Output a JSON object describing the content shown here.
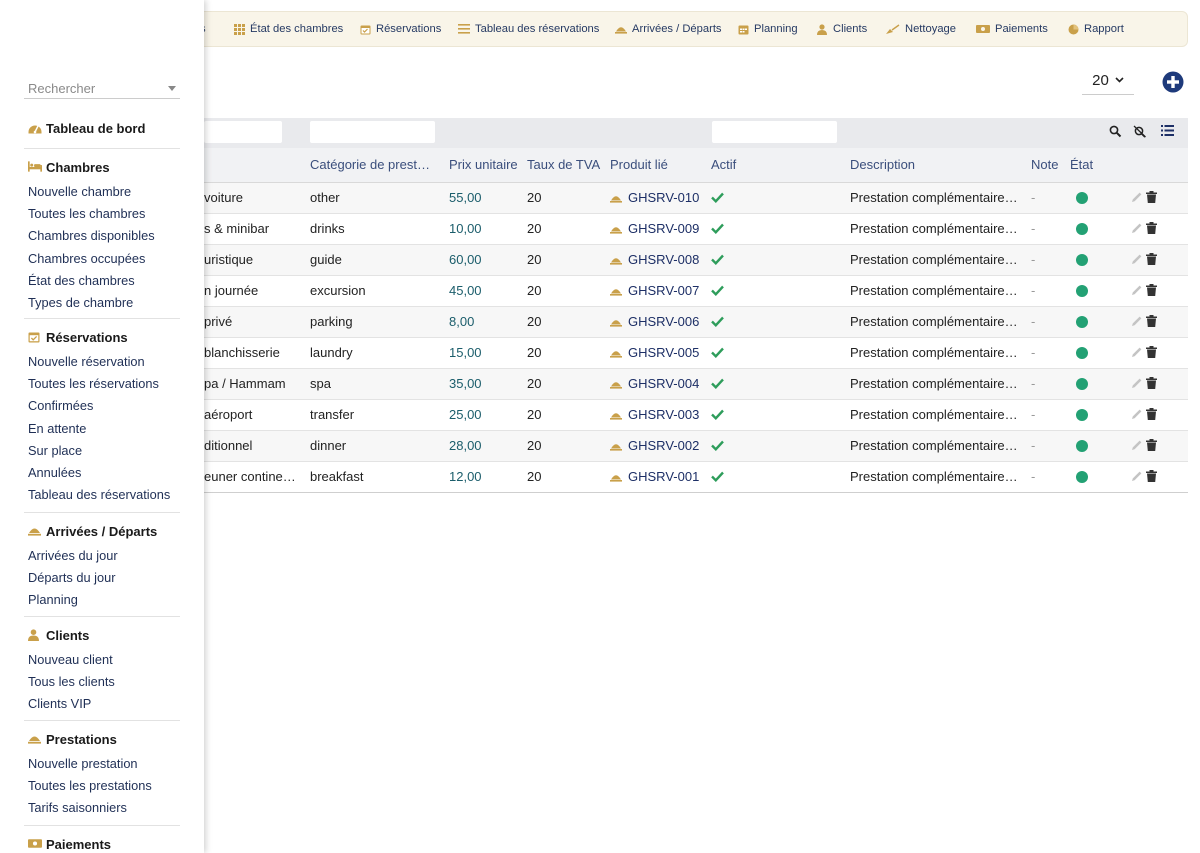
{
  "top_menu": [
    {
      "label": "s",
      "icon": "hidden-icon"
    },
    {
      "label": "État des chambres",
      "icon": "grid-icon"
    },
    {
      "label": "Réservations",
      "icon": "calendar-check-icon"
    },
    {
      "label": "Tableau des réservations",
      "icon": "list-icon"
    },
    {
      "label": "Arrivées / Départs",
      "icon": "bell-icon"
    },
    {
      "label": "Planning",
      "icon": "calendar-icon"
    },
    {
      "label": "Clients",
      "icon": "user-icon"
    },
    {
      "label": "Nettoyage",
      "icon": "broom-icon"
    },
    {
      "label": "Paiements",
      "icon": "money-icon"
    },
    {
      "label": "Rapport",
      "icon": "pie-chart-icon"
    }
  ],
  "list": {
    "page_size": "20",
    "headers": [
      "Catégorie de prestat…",
      "Prix unitaire",
      "Taux de TVA",
      "Produit lié",
      "Actif",
      "Description",
      "Note",
      "État"
    ],
    "rows": [
      {
        "name": "voiture",
        "category": "other",
        "price": "55,00",
        "vat": "20",
        "product": "GHSRV-010",
        "description": "Prestation complémentaire -…",
        "note": "-"
      },
      {
        "name": "s & minibar",
        "category": "drinks",
        "price": "10,00",
        "vat": "20",
        "product": "GHSRV-009",
        "description": "Prestation complémentaire -…",
        "note": "-"
      },
      {
        "name": "uristique",
        "category": "guide",
        "price": "60,00",
        "vat": "20",
        "product": "GHSRV-008",
        "description": "Prestation complémentaire -…",
        "note": "-"
      },
      {
        "name": "n journée",
        "category": "excursion",
        "price": "45,00",
        "vat": "20",
        "product": "GHSRV-007",
        "description": "Prestation complémentaire -…",
        "note": "-"
      },
      {
        "name": "privé",
        "category": "parking",
        "price": "8,00",
        "vat": "20",
        "product": "GHSRV-006",
        "description": "Prestation complémentaire -…",
        "note": "-"
      },
      {
        "name": "blanchisserie",
        "category": "laundry",
        "price": "15,00",
        "vat": "20",
        "product": "GHSRV-005",
        "description": "Prestation complémentaire -…",
        "note": "-"
      },
      {
        "name": "pa / Hammam",
        "category": "spa",
        "price": "35,00",
        "vat": "20",
        "product": "GHSRV-004",
        "description": "Prestation complémentaire -…",
        "note": "-"
      },
      {
        "name": "aéroport",
        "category": "transfer",
        "price": "25,00",
        "vat": "20",
        "product": "GHSRV-003",
        "description": "Prestation complémentaire -…",
        "note": "-"
      },
      {
        "name": "ditionnel",
        "category": "dinner",
        "price": "28,00",
        "vat": "20",
        "product": "GHSRV-002",
        "description": "Prestation complémentaire -…",
        "note": "-"
      },
      {
        "name": "euner continental",
        "category": "breakfast",
        "price": "12,00",
        "vat": "20",
        "product": "GHSRV-001",
        "description": "Prestation complémentaire -…",
        "note": "-"
      }
    ]
  },
  "sidebar": {
    "search_placeholder": "Rechercher",
    "dashboard": "Tableau de bord",
    "sections": [
      {
        "title": "Chambres",
        "icon": "bed-icon",
        "items": [
          "Nouvelle chambre",
          "Toutes les chambres",
          "Chambres disponibles",
          "Chambres occupées",
          "État des chambres",
          "Types de chambre"
        ]
      },
      {
        "title": "Réservations",
        "icon": "calendar-check-icon",
        "items": [
          "Nouvelle réservation",
          "Toutes les réservations",
          "Confirmées",
          "En attente",
          "Sur place",
          "Annulées",
          "Tableau des réservations"
        ]
      },
      {
        "title": "Arrivées / Départs",
        "icon": "bell-icon",
        "items": [
          "Arrivées du jour",
          "Départs du jour",
          "Planning"
        ]
      },
      {
        "title": "Clients",
        "icon": "user-icon",
        "items": [
          "Nouveau client",
          "Tous les clients",
          "Clients VIP"
        ]
      },
      {
        "title": "Prestations",
        "icon": "bell-icon",
        "items": [
          "Nouvelle prestation",
          "Toutes les prestations",
          "Tarifs saisonniers"
        ]
      },
      {
        "title": "Paiements",
        "icon": "money-icon",
        "items": []
      }
    ]
  },
  "colors": {
    "accent": "#c9a04a",
    "link": "#1d2f66",
    "status_active": "#23a174",
    "check": "#2e9d5b",
    "add_button": "#1e3a7b"
  }
}
